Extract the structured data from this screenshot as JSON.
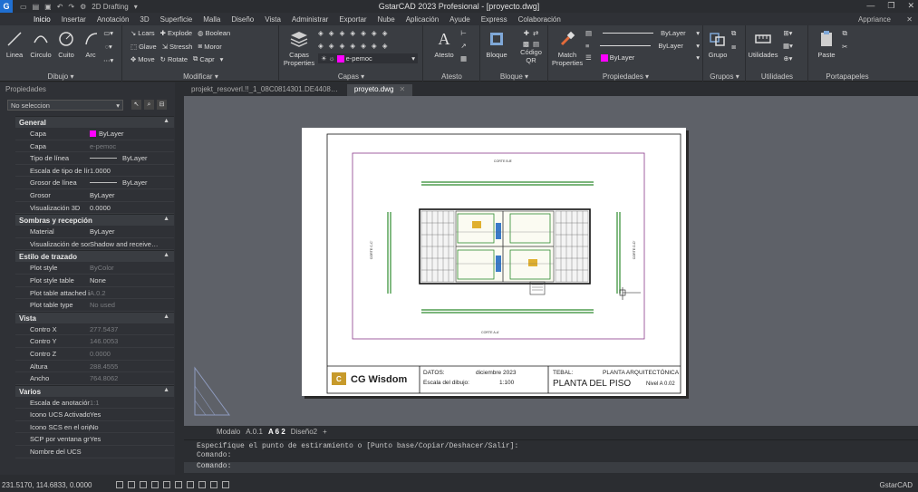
{
  "titlebar": {
    "workspace": "2D Drafting",
    "title": "GstarCAD 2023 Profesional - [proyecto.dwg]"
  },
  "menu": {
    "items": [
      "Inicio",
      "Insertar",
      "Anotación",
      "3D",
      "Superficie",
      "Malla",
      "Diseño",
      "Vista",
      "Administrar",
      "Exportar",
      "Nube",
      "Aplicación",
      "Ayude",
      "Express",
      "Colaboración"
    ],
    "appearance": "Appriance"
  },
  "ribbon": {
    "draw": {
      "label": "Dibujo",
      "tools": [
        "Linea",
        "Circulo",
        "Cuito",
        "Arc"
      ]
    },
    "modify": {
      "label": "Modificar",
      "rows": [
        [
          "Lcars",
          "Explode",
          "Boolean"
        ],
        [
          "Glave",
          "Stressh",
          "Moror"
        ],
        [
          "Move",
          "Rotate",
          "Capr"
        ]
      ]
    },
    "layers": {
      "label": "Capas",
      "button": "Capas Properties",
      "current": "e-pemoc"
    },
    "annotate": {
      "label": "Atesto",
      "button": "Atesto"
    },
    "block": {
      "label": "Bloque",
      "buttons": [
        "Bloque",
        "Código QR"
      ]
    },
    "properties": {
      "label": "Propiedades",
      "button": "Match Properties",
      "bylayer1": "ByLayer",
      "bylayer2": "ByLayer",
      "bylayer3": "ByLayer"
    },
    "groups": {
      "label": "Grupos",
      "button": "Grupo"
    },
    "utilities": {
      "label": "Utilidades",
      "button": "Utilidades"
    },
    "clipboard": {
      "label": "Portapapeles",
      "button": "Paste"
    }
  },
  "panel": {
    "title": "Propiedades",
    "selection": "No seleccion",
    "sections": [
      {
        "name": "General",
        "rows": [
          {
            "k": "Capa",
            "v": "ByLayer",
            "swatch": "#ff00ff"
          },
          {
            "k": "Capa",
            "v": "e-pemoc",
            "dim": true
          },
          {
            "k": "Tipo de línea",
            "v": "ByLayer",
            "line": true
          },
          {
            "k": "Escala de tipo de línea",
            "v": "1.0000"
          },
          {
            "k": "Grosor de línea",
            "v": "ByLayer",
            "line": true
          },
          {
            "k": "Grosor",
            "v": "ByLayer"
          },
          {
            "k": "Visualización 3D",
            "v": "0.0000"
          }
        ]
      },
      {
        "name": "Sombras y recepción",
        "rows": [
          {
            "k": "Material",
            "v": "ByLayer"
          },
          {
            "k": "Visualización de sombras",
            "v": "Shadow and receive…"
          }
        ]
      },
      {
        "name": "Estilo de trazado",
        "rows": [
          {
            "k": "Plot style",
            "v": "ByColor",
            "dim": true
          },
          {
            "k": "Plot style table",
            "v": "None"
          },
          {
            "k": "Plot table attached ia",
            "v": "A.0.2",
            "dim": true
          },
          {
            "k": "Plot table type",
            "v": "No used",
            "dim": true
          }
        ]
      },
      {
        "name": "Vista",
        "rows": [
          {
            "k": "Contro X",
            "v": "277.5437",
            "dim": true
          },
          {
            "k": "Contro Y",
            "v": "146.0053",
            "dim": true
          },
          {
            "k": "Contro Z",
            "v": "0.0000",
            "dim": true
          },
          {
            "k": "Altura",
            "v": "288.4555",
            "dim": true
          },
          {
            "k": "Ancho",
            "v": "764.8062",
            "dim": true
          }
        ]
      },
      {
        "name": "Varios",
        "rows": [
          {
            "k": "Escala de anotación",
            "v": "1:1",
            "dim": true
          },
          {
            "k": "Icono UCS Activado",
            "v": "Yes"
          },
          {
            "k": "Icono SCS en el origen",
            "v": "No"
          },
          {
            "k": "SCP por ventana gráfica",
            "v": "Yes"
          },
          {
            "k": "Nombre del UCS",
            "v": ""
          }
        ]
      }
    ]
  },
  "tabs": [
    {
      "label": "projekt_resoverl.!!_1_08C0814301.DE4408…",
      "active": false
    },
    {
      "label": "proyeto.dwg",
      "active": true
    }
  ],
  "drawing": {
    "brand": "CG Wisdom",
    "datos_label": "DATOS:",
    "date": "diciembre 2023",
    "scale_label": "Escala del dibujo:",
    "scale": "1:100",
    "tebal_label": "TEBAL:",
    "project": "PLANTA ARQUITECTÓNICA",
    "sheet_title": "PLANTA DEL PISO",
    "level": "Nivel A 0.02",
    "top_label": "CORTE B-B'",
    "bottom_label": "CORTE A-A'",
    "left_label": "CORTE C-C'",
    "right_label": "CORTE D-D'"
  },
  "layouts": {
    "items": [
      "Modalo",
      "A.0.1",
      "A 6 2",
      "Diseño2",
      "+"
    ],
    "active": "A 6 2"
  },
  "command": {
    "history": "Especifique el punto de estiramiento o [Punto base/Copiar/Deshacer/Salir]:",
    "line2": "Comando:",
    "prompt": "Comando:"
  },
  "status": {
    "coords": "231.5170, 114.6833, 0.0000",
    "app": "GstarCAD"
  }
}
